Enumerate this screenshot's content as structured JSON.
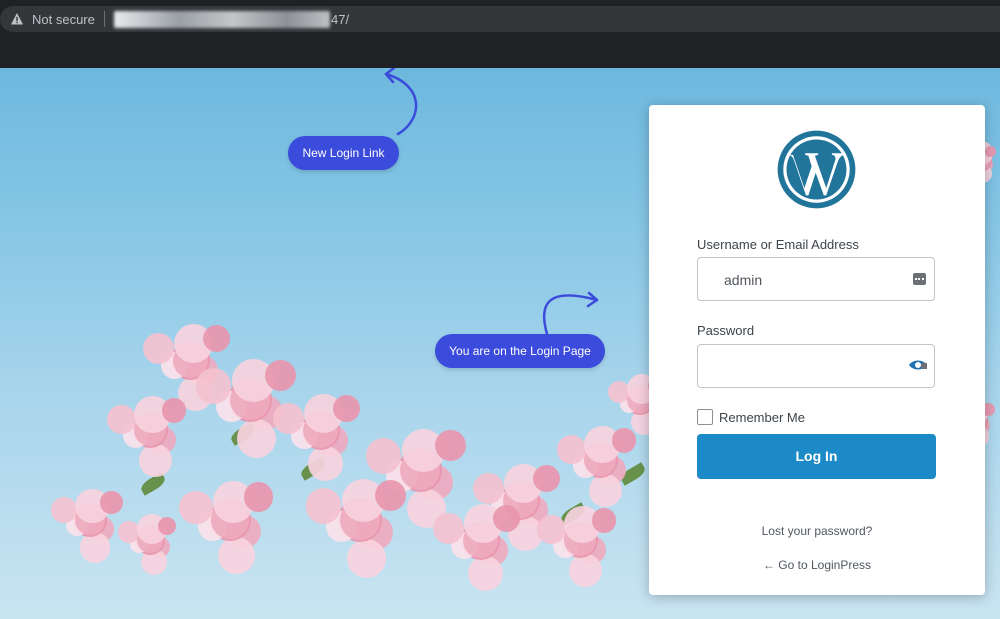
{
  "browser": {
    "security_label": "Not secure",
    "url_visible_tail": "47/"
  },
  "callouts": {
    "new_login_link": "New Login Link",
    "on_login_page": "You are on the Login Page"
  },
  "login_form": {
    "username_label": "Username or Email Address",
    "username_value": "admin",
    "password_label": "Password",
    "password_value": "",
    "remember_label": "Remember Me",
    "remember_checked": false,
    "submit_label": "Log In",
    "lost_password_link": "Lost your password?",
    "back_link": "← Go to LoginPress"
  },
  "icons": {
    "warning": "warning-triangle-icon",
    "logo": "wordpress-logo-icon",
    "password_manager": "key-icon",
    "show_password": "eye-icon"
  },
  "colors": {
    "callout": "#3b4bdb",
    "button": "#1b8ac6",
    "wordpress_blue": "#21759b"
  }
}
